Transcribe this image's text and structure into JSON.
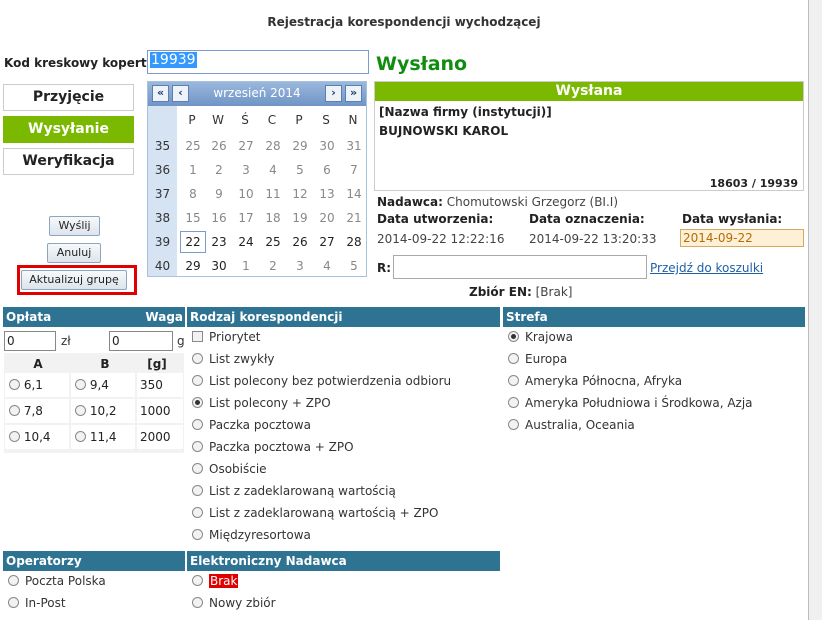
{
  "page_title": "Rejestracja korespondencji wychodzącej",
  "barcode": {
    "label": "Kod kreskowy koperty",
    "value": "19939"
  },
  "status_big": "Wysłano",
  "nav": [
    {
      "label": "Przyjęcie",
      "active": false
    },
    {
      "label": "Wysyłanie",
      "active": true
    },
    {
      "label": "Weryfikacja",
      "active": false
    }
  ],
  "calendar": {
    "month_label": "wrzesień 2014",
    "nav_prev_year": "«",
    "nav_prev_month": "‹",
    "nav_next_month": "›",
    "nav_next_year": "»",
    "day_names": [
      "P",
      "W",
      "Ś",
      "C",
      "P",
      "S",
      "N"
    ],
    "weeks": [
      {
        "num": "35",
        "days": [
          "25",
          "26",
          "27",
          "28",
          "29",
          "30",
          "31"
        ],
        "current": [
          false,
          false,
          false,
          false,
          false,
          false,
          false
        ]
      },
      {
        "num": "36",
        "days": [
          "1",
          "2",
          "3",
          "4",
          "5",
          "6",
          "7"
        ],
        "current": [
          false,
          false,
          false,
          false,
          false,
          false,
          false
        ]
      },
      {
        "num": "37",
        "days": [
          "8",
          "9",
          "10",
          "11",
          "12",
          "13",
          "14"
        ],
        "current": [
          false,
          false,
          false,
          false,
          false,
          false,
          false
        ]
      },
      {
        "num": "38",
        "days": [
          "15",
          "16",
          "17",
          "18",
          "19",
          "20",
          "21"
        ],
        "current": [
          false,
          false,
          false,
          false,
          false,
          false,
          false
        ]
      },
      {
        "num": "39",
        "days": [
          "22",
          "23",
          "24",
          "25",
          "26",
          "27",
          "28"
        ],
        "current": [
          true,
          true,
          true,
          true,
          true,
          true,
          true
        ]
      },
      {
        "num": "40",
        "days": [
          "29",
          "30",
          "1",
          "2",
          "3",
          "4",
          "5"
        ],
        "current": [
          true,
          true,
          false,
          false,
          false,
          false,
          false
        ]
      }
    ],
    "today": "22"
  },
  "buttons": {
    "send": "Wyślij",
    "cancel": "Anuluj",
    "update_group": "Aktualizuj grupę"
  },
  "status_panel": {
    "header": "Wysłana",
    "firm_label": "[Nazwa firmy (instytucji)]",
    "firm_name": "BUJNOWSKI KAROL",
    "counter": "18603 / 19939"
  },
  "sender": {
    "label": "Nadawca:",
    "value": "Chomutowski Grzegorz (BI.I)"
  },
  "dates": {
    "created_label": "Data utworzenia:",
    "created_value": "2014-09-22 12:22:16",
    "marked_label": "Data oznaczenia:",
    "marked_value": "2014-09-22 13:20:33",
    "sent_label": "Data wysłania:",
    "sent_value": "2014-09-22"
  },
  "r_field": {
    "label": "R:",
    "value": "",
    "link": "Przejdź do koszulki"
  },
  "zbior": {
    "label": "Zbiór EN:",
    "value": "[Brak]"
  },
  "oplata": {
    "header": "Opłata",
    "weight_header": "Waga",
    "fee_value": "0",
    "fee_unit": "zł",
    "weight_value": "0",
    "weight_unit": "g",
    "col_a": "A",
    "col_b": "B",
    "col_g": "[g]",
    "rows": [
      {
        "a": "6,1",
        "b": "9,4",
        "g": "350"
      },
      {
        "a": "7,8",
        "b": "10,2",
        "g": "1000"
      },
      {
        "a": "10,4",
        "b": "11,4",
        "g": "2000"
      }
    ]
  },
  "rodzaj": {
    "header": "Rodzaj korespondencji",
    "priority": "Priorytet",
    "options": [
      {
        "label": "List zwykły",
        "selected": false
      },
      {
        "label": "List polecony bez potwierdzenia odbioru",
        "selected": false
      },
      {
        "label": "List polecony + ZPO",
        "selected": true
      },
      {
        "label": "Paczka pocztowa",
        "selected": false
      },
      {
        "label": "Paczka pocztowa + ZPO",
        "selected": false
      },
      {
        "label": "Osobiście",
        "selected": false
      },
      {
        "label": "List z zadeklarowaną wartością",
        "selected": false
      },
      {
        "label": "List z zadeklarowaną wartością + ZPO",
        "selected": false
      },
      {
        "label": "Międzyresortowa",
        "selected": false
      }
    ]
  },
  "strefa": {
    "header": "Strefa",
    "options": [
      {
        "label": "Krajowa",
        "selected": true
      },
      {
        "label": "Europa",
        "selected": false
      },
      {
        "label": "Ameryka Północna, Afryka",
        "selected": false
      },
      {
        "label": "Ameryka Południowa i Środkowa, Azja",
        "selected": false
      },
      {
        "label": "Australia, Oceania",
        "selected": false
      }
    ]
  },
  "operatorzy": {
    "header": "Operatorzy",
    "options": [
      {
        "label": "Poczta Polska",
        "selected": false
      },
      {
        "label": "In-Post",
        "selected": false
      }
    ]
  },
  "nadawca_el": {
    "header": "Elektroniczny Nadawca",
    "options": [
      {
        "label": "Brak",
        "selected": false
      },
      {
        "label": "Nowy zbiór",
        "selected": false
      }
    ]
  },
  "colors": {
    "green": "#7ab900",
    "section_blue": "#2f7393",
    "status_green": "#108c10",
    "highlight_red": "#e00000"
  }
}
